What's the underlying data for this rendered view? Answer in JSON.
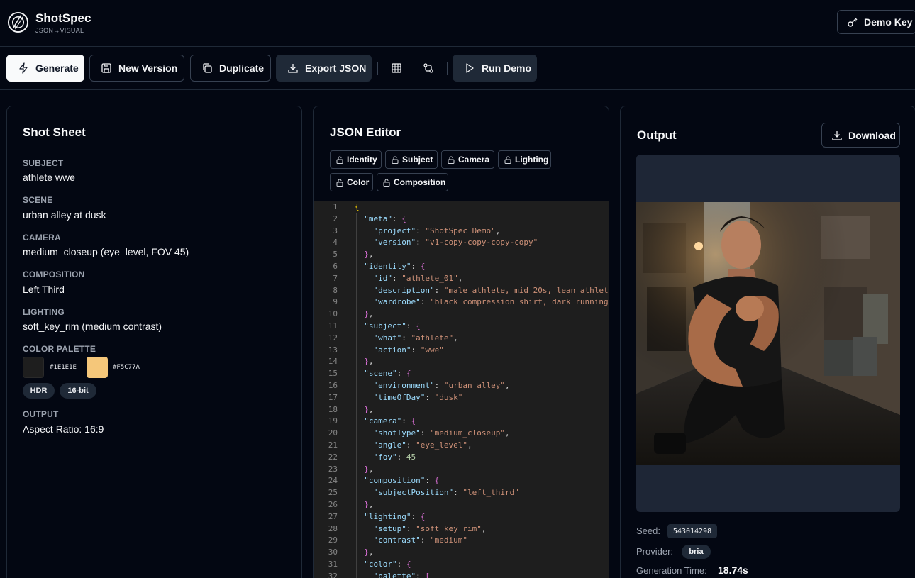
{
  "brand": {
    "name": "ShotSpec",
    "tagline": "JSON→VISUAL",
    "logo_icon": "lens-ring-icon"
  },
  "header": {
    "demo_key_label": "Demo Key",
    "demo_key_icon": "key-icon"
  },
  "toolbar": {
    "generate_label": "Generate",
    "new_version_label": "New Version",
    "duplicate_label": "Duplicate",
    "export_label": "Export JSON",
    "run_demo_label": "Run Demo",
    "icons": [
      "lightning-icon",
      "save-icon",
      "copy-icon",
      "download-icon",
      "grid-icon",
      "compare-icon",
      "play-icon"
    ]
  },
  "shot_sheet": {
    "title": "Shot Sheet",
    "fields": [
      {
        "label": "SUBJECT",
        "value": "athlete wwe"
      },
      {
        "label": "SCENE",
        "value": "urban alley at dusk"
      },
      {
        "label": "CAMERA",
        "value": "medium_closeup (eye_level, FOV 45)"
      },
      {
        "label": "COMPOSITION",
        "value": "Left Third"
      },
      {
        "label": "LIGHTING",
        "value": "soft_key_rim (medium contrast)"
      }
    ],
    "palette_label": "COLOR PALETTE",
    "palette": [
      {
        "hex": "#1E1E1E",
        "color": "#1e1e1e"
      },
      {
        "hex": "#F5C77A",
        "color": "#f5c77a"
      }
    ],
    "tags": [
      "HDR",
      "16-bit"
    ],
    "output_label": "OUTPUT",
    "output_value": "Aspect Ratio: 16:9"
  },
  "json_editor": {
    "title": "JSON Editor",
    "lock_chips": [
      "Identity",
      "Subject",
      "Camera",
      "Lighting",
      "Color",
      "Composition"
    ],
    "lines": [
      "{",
      "  \"meta\": {",
      "    \"project\": \"ShotSpec Demo\",",
      "    \"version\": \"v1-copy-copy-copy-copy\"",
      "  },",
      "  \"identity\": {",
      "    \"id\": \"athlete_01\",",
      "    \"description\": \"male athlete, mid 20s, lean athlet",
      "    \"wardrobe\": \"black compression shirt, dark running",
      "  },",
      "  \"subject\": {",
      "    \"what\": \"athlete\",",
      "    \"action\": \"wwe\"",
      "  },",
      "  \"scene\": {",
      "    \"environment\": \"urban alley\",",
      "    \"timeOfDay\": \"dusk\"",
      "  },",
      "  \"camera\": {",
      "    \"shotType\": \"medium_closeup\",",
      "    \"angle\": \"eye_level\",",
      "    \"fov\": 45",
      "  },",
      "  \"composition\": {",
      "    \"subjectPosition\": \"left_third\"",
      "  },",
      "  \"lighting\": {",
      "    \"setup\": \"soft_key_rim\",",
      "    \"contrast\": \"medium\"",
      "  },",
      "  \"color\": {",
      "    \"palette\": ["
    ]
  },
  "output": {
    "title": "Output",
    "download_label": "Download",
    "seed_label": "Seed:",
    "seed_value": "543014298",
    "provider_label": "Provider:",
    "provider_value": "bria",
    "generation_time_label": "Generation Time:",
    "generation_time_value": "18.74s"
  },
  "colors": {
    "background": "#030712",
    "border": "#1f2937",
    "muted_text": "#9ca3af",
    "editor_bg": "#1e1e1e",
    "json_key": "#9cdcfe",
    "json_string": "#ce9178",
    "json_number": "#b5cea8"
  }
}
